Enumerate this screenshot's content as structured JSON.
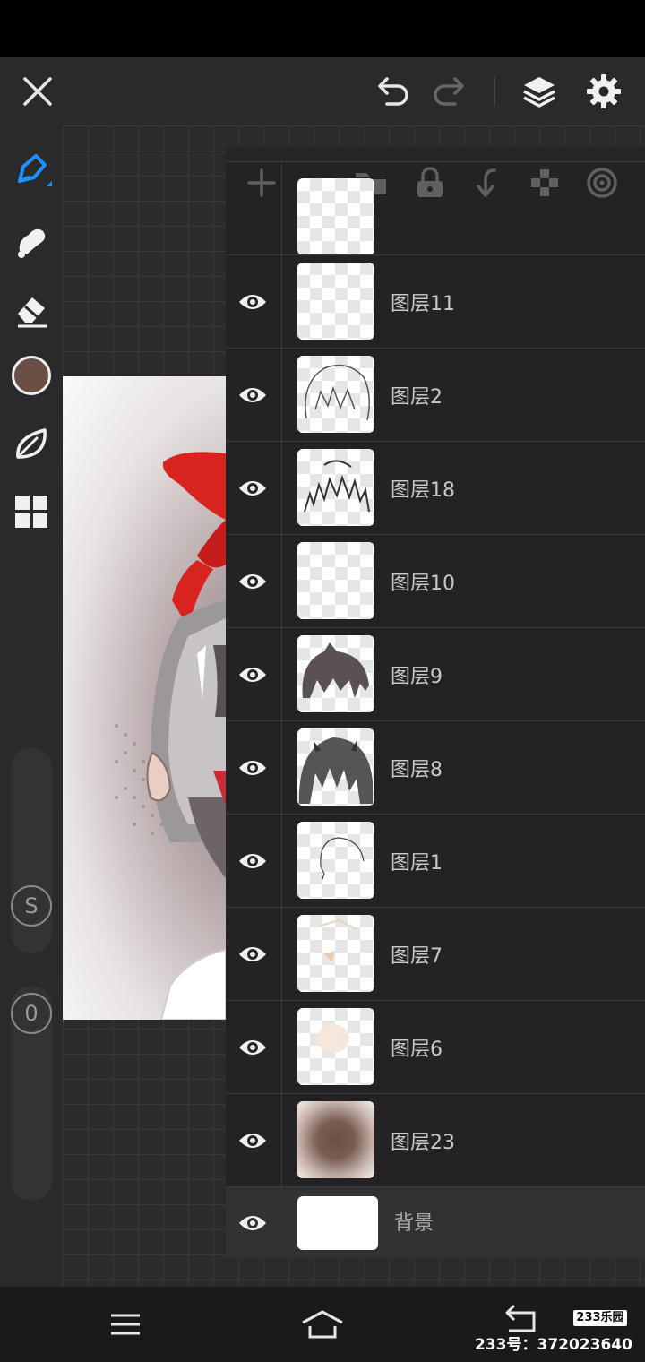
{
  "toolbar": {
    "icons": [
      "close-icon",
      "undo-icon",
      "redo-icon",
      "layers-icon",
      "settings-icon"
    ]
  },
  "tools": {
    "items": [
      "brush-icon",
      "smudge-icon",
      "eraser-icon",
      "color-swatch",
      "leaf-icon",
      "grid-icon"
    ],
    "current_color": "#6b4f45",
    "size_slider_label": "S",
    "opacity_slider_label": "0"
  },
  "layers_toolbar": {
    "icons": [
      "add-layer-icon",
      "folder-icon",
      "lock-icon",
      "merge-down-icon",
      "transparency-icon",
      "blend-mode-icon"
    ]
  },
  "layers": [
    {
      "name": "图层11",
      "visible": true
    },
    {
      "name": "图层2",
      "visible": true
    },
    {
      "name": "图层18",
      "visible": true
    },
    {
      "name": "图层10",
      "visible": true
    },
    {
      "name": "图层9",
      "visible": true
    },
    {
      "name": "图层8",
      "visible": true
    },
    {
      "name": "图层1",
      "visible": true
    },
    {
      "name": "图层7",
      "visible": true
    },
    {
      "name": "图层6",
      "visible": true
    },
    {
      "name": "图层23",
      "visible": true
    },
    {
      "name": "背景",
      "visible": true
    }
  ],
  "colors": {
    "accent": "#1e90ff",
    "panel": "#262628",
    "hair": "#5a5252"
  },
  "nav": {
    "icons": [
      "menu-icon",
      "home-icon",
      "back-icon"
    ]
  },
  "watermark": {
    "logo": "233乐园",
    "text": "233号：372023640"
  }
}
